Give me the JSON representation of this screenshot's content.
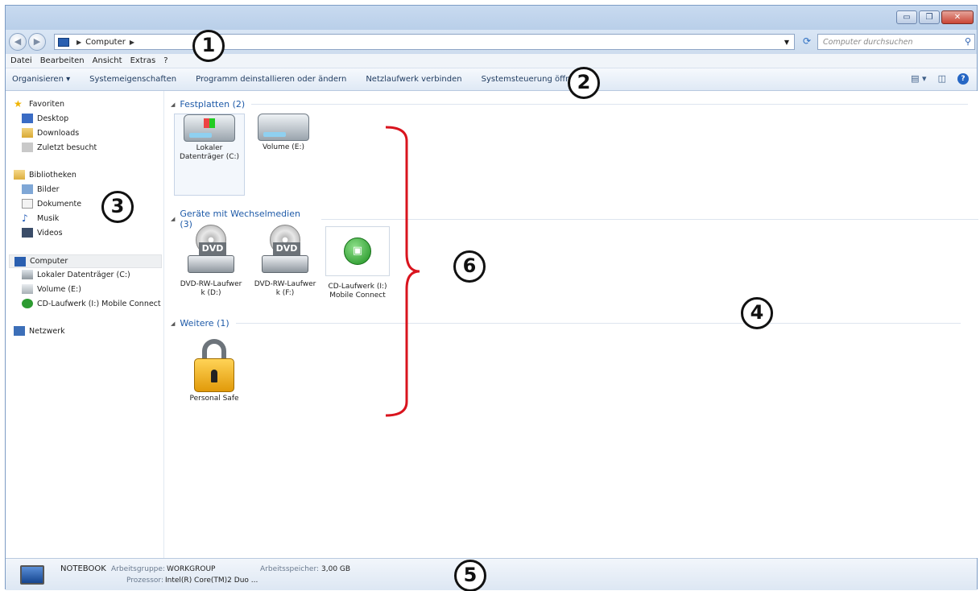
{
  "window": {
    "buttons": {
      "minimize": "▭",
      "maximize": "❐",
      "close": "✕"
    }
  },
  "address": {
    "crumbs": [
      "Computer"
    ],
    "search_placeholder": "Computer durchsuchen"
  },
  "menu": [
    "Datei",
    "Bearbeiten",
    "Ansicht",
    "Extras",
    "?"
  ],
  "commands": [
    "Organisieren ▾",
    "Systemeigenschaften",
    "Programm deinstallieren oder ändern",
    "Netzlaufwerk verbinden",
    "Systemsteuerung öffnen"
  ],
  "nav": {
    "favorites": "Favoriten",
    "desktop": "Desktop",
    "downloads": "Downloads",
    "recent": "Zuletzt besucht",
    "libraries": "Bibliotheken",
    "pictures": "Bilder",
    "documents": "Dokumente",
    "music": "Musik",
    "videos": "Videos",
    "computer": "Computer",
    "drive_c": "Lokaler Datenträger (C:)",
    "drive_e": "Volume (E:)",
    "drive_i": "CD-Laufwerk (I:) Mobile Connect",
    "network": "Netzwerk"
  },
  "groups": {
    "hdd": "Festplatten (2)",
    "removable": "Geräte mit Wechselmedien (3)",
    "other": "Weitere (1)"
  },
  "items": {
    "c_line1": "Lokaler",
    "c_line2": "Datenträger (C:)",
    "e": "Volume (E:)",
    "d_line1": "DVD-RW-Laufwer",
    "d_line2": "k (D:)",
    "f_line1": "DVD-RW-Laufwer",
    "f_line2": "k (F:)",
    "i_line1": "CD-Laufwerk (I:)",
    "i_line2": "Mobile Connect",
    "dvd_label": "DVD",
    "safe": "Personal Safe"
  },
  "details": {
    "name": "NOTEBOOK",
    "workgroup_label": "Arbeitsgruppe:",
    "workgroup_value": "WORKGROUP",
    "memory_label": "Arbeitsspeicher:",
    "memory_value": "3,00 GB",
    "cpu_label": "Prozessor:",
    "cpu_value": "Intel(R) Core(TM)2 Duo ..."
  },
  "annotations": [
    "1",
    "2",
    "3",
    "4",
    "5",
    "6"
  ],
  "colors": {
    "accent": "#1e5aa8",
    "brace": "#d9141e"
  }
}
